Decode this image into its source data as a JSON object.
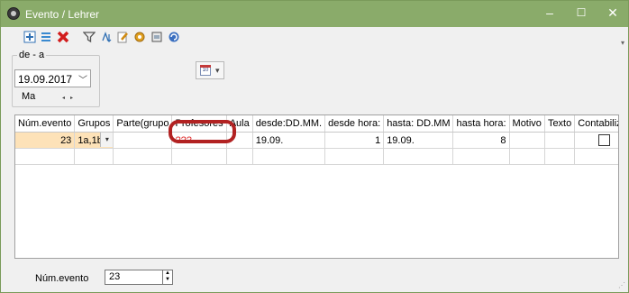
{
  "window": {
    "title": "Evento / Lehrer",
    "minimize_glyph": "–",
    "maximize_glyph": "☐",
    "close_glyph": "✕"
  },
  "toolbar": {
    "icons": [
      "new-row-icon",
      "list-icon",
      "delete-icon",
      "filter-icon",
      "sort-icon",
      "edit-icon",
      "settings-icon",
      "print-icon",
      "refresh-icon"
    ],
    "more_glyph": "▾"
  },
  "filter": {
    "group_label": "de - a",
    "date_value": "19.09.2017",
    "day_label": "Ma",
    "nav_glyphs": "◂▸"
  },
  "calendar_button": {
    "icon_text": "10",
    "drop_glyph": "▾"
  },
  "grid": {
    "columns": [
      "Núm.evento",
      "Grupos",
      "Parte(grupo",
      "Profesores",
      "Aula",
      "desde:DD.MM.",
      "desde hora:",
      "hasta: DD.MM",
      "hasta hora:",
      "Motivo",
      "Texto",
      "Contabilizar"
    ],
    "row1": {
      "num_evento": "23",
      "grupos": "1a,1b",
      "parte": "",
      "profesores": "???",
      "aula": "",
      "desde_fecha": "19.09.",
      "desde_hora": "1",
      "hasta_fecha": "19.09.",
      "hasta_hora": "8",
      "motivo": "",
      "texto": "",
      "contabilizar": false
    },
    "combo_glyph": "▾"
  },
  "statusbar": {
    "label": "Núm.evento",
    "value": "23",
    "spin_up": "▲",
    "spin_down": "▼",
    "grip": "⋰"
  },
  "colors": {
    "titlebar": "#8aab6a",
    "highlight_ring": "#b22222",
    "selected_cell": "#fde2b8",
    "missing_teacher": "#e03030"
  }
}
